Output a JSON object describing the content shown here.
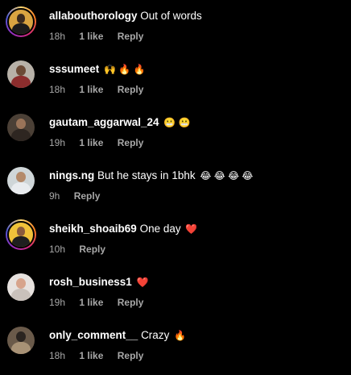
{
  "comments": [
    {
      "username": "allabouthorology",
      "text": "Out of words",
      "emoji": "",
      "time": "18h",
      "likes": "1 like",
      "reply": "Reply",
      "has_story_ring": true,
      "avatar_colors": {
        "bg": "#d9a441",
        "head": "#3a2a1e",
        "body": "#1b1b1b"
      }
    },
    {
      "username": "sssumeet",
      "text": "",
      "emoji": "🙌 🔥 🔥",
      "time": "18h",
      "likes": "1 like",
      "reply": "Reply",
      "has_story_ring": false,
      "avatar_colors": {
        "bg": "#b7b1a8",
        "head": "#6b4a36",
        "body": "#8c2d2d"
      }
    },
    {
      "username": "gautam_aggarwal_24",
      "text": "",
      "emoji": "😬 😬",
      "time": "19h",
      "likes": "1 like",
      "reply": "Reply",
      "has_story_ring": false,
      "avatar_colors": {
        "bg": "#4b4036",
        "head": "#9a7459",
        "body": "#2e2621"
      }
    },
    {
      "username": "nings.ng",
      "text": "But he stays in 1bhk",
      "emoji": "😂 😂 😂 😂",
      "time": "9h",
      "likes": "",
      "reply": "Reply",
      "has_story_ring": false,
      "avatar_colors": {
        "bg": "#cfd6d8",
        "head": "#b48a6a",
        "body": "#e9ecef"
      }
    },
    {
      "username": "sheikh_shoaib69",
      "text": "One day",
      "emoji": "❤️",
      "time": "10h",
      "likes": "",
      "reply": "Reply",
      "has_story_ring": true,
      "avatar_colors": {
        "bg": "#f0c23a",
        "head": "#8a5b3d",
        "body": "#1f1f1f"
      }
    },
    {
      "username": "rosh_business1",
      "text": "",
      "emoji": "❤️",
      "time": "19h",
      "likes": "1 like",
      "reply": "Reply",
      "has_story_ring": false,
      "avatar_colors": {
        "bg": "#e7e2df",
        "head": "#d7a48c",
        "body": "#c9c1bb"
      }
    },
    {
      "username": "only_comment__",
      "text": "Crazy",
      "emoji": "🔥",
      "time": "18h",
      "likes": "1 like",
      "reply": "Reply",
      "has_story_ring": false,
      "avatar_colors": {
        "bg": "#6a5a4a",
        "head": "#2a2420",
        "body": "#a89276"
      }
    }
  ]
}
